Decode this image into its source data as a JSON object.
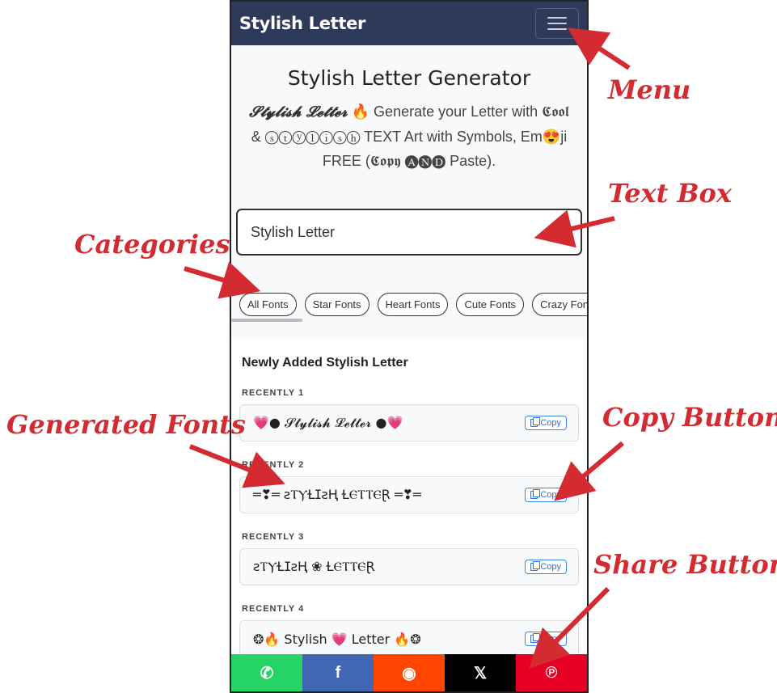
{
  "navbar": {
    "brand": "Stylish Letter"
  },
  "hero": {
    "title": "Stylish Letter Generator",
    "desc_fancy": "𝓢𝓽𝔂𝓵𝓲𝓼𝓱 𝓛𝓮𝓽𝓽𝓮𝓻",
    "desc_rest": " 🔥 Generate your Letter with 𝕮𝖔𝖔𝖑 & ⓢⓣⓨⓛⓘⓢⓗ TEXT Art with Symbols, Em😍ji FREE (𝕮𝖔𝖕𝖞 🅐🅝🅓 Paste)."
  },
  "textbox": {
    "value": "Stylish Letter"
  },
  "categories": [
    "All Fonts",
    "Star Fonts",
    "Heart Fonts",
    "Cute Fonts",
    "Crazy Fonts"
  ],
  "list": {
    "heading": "Newly Added Stylish Letter",
    "items": [
      {
        "label": "RECENTLY 1",
        "text": "💗● 𝓢𝓽𝔂𝓵𝓲𝓼𝓱 𝓛𝓮𝓽𝓽𝓮𝓻 ●💗",
        "copy": "Copy"
      },
      {
        "label": "RECENTLY 2",
        "text": "═❣═ ꙅⲦⲨⱢⵊꙅⱧ ⱢⲈⲦⲦⲈⱤ ═❣═",
        "copy": "Copy"
      },
      {
        "label": "RECENTLY 3",
        "text": "ꙅⲦⲨⱢⵊꙅⱧ ❀ ⱢⲈⲦⲦⲈⱤ",
        "copy": "Copy"
      },
      {
        "label": "RECENTLY 4",
        "text": "❂🔥 Stylish 💗 Letter 🔥❂",
        "copy": "Copy"
      }
    ]
  },
  "share": [
    {
      "icon": "whatsapp-icon",
      "glyph": "✆",
      "color": "#25d366"
    },
    {
      "icon": "facebook-icon",
      "glyph": "f",
      "color": "#4267b2"
    },
    {
      "icon": "reddit-icon",
      "glyph": "◉",
      "color": "#ff4500"
    },
    {
      "icon": "x-icon",
      "glyph": "𝕏",
      "color": "#000000"
    },
    {
      "icon": "pinterest-icon",
      "glyph": "℗",
      "color": "#e60023"
    }
  ],
  "annotations": {
    "menu": "Menu",
    "text_box": "Text Box",
    "categories": "Categories",
    "generated_fonts": "Generated Fonts",
    "copy_button": "Copy Button",
    "share_button": "Share Button"
  },
  "colors": {
    "navbar": "#2f3a5a",
    "annotation": "#d42a32",
    "copy": "#2f6fe0"
  }
}
